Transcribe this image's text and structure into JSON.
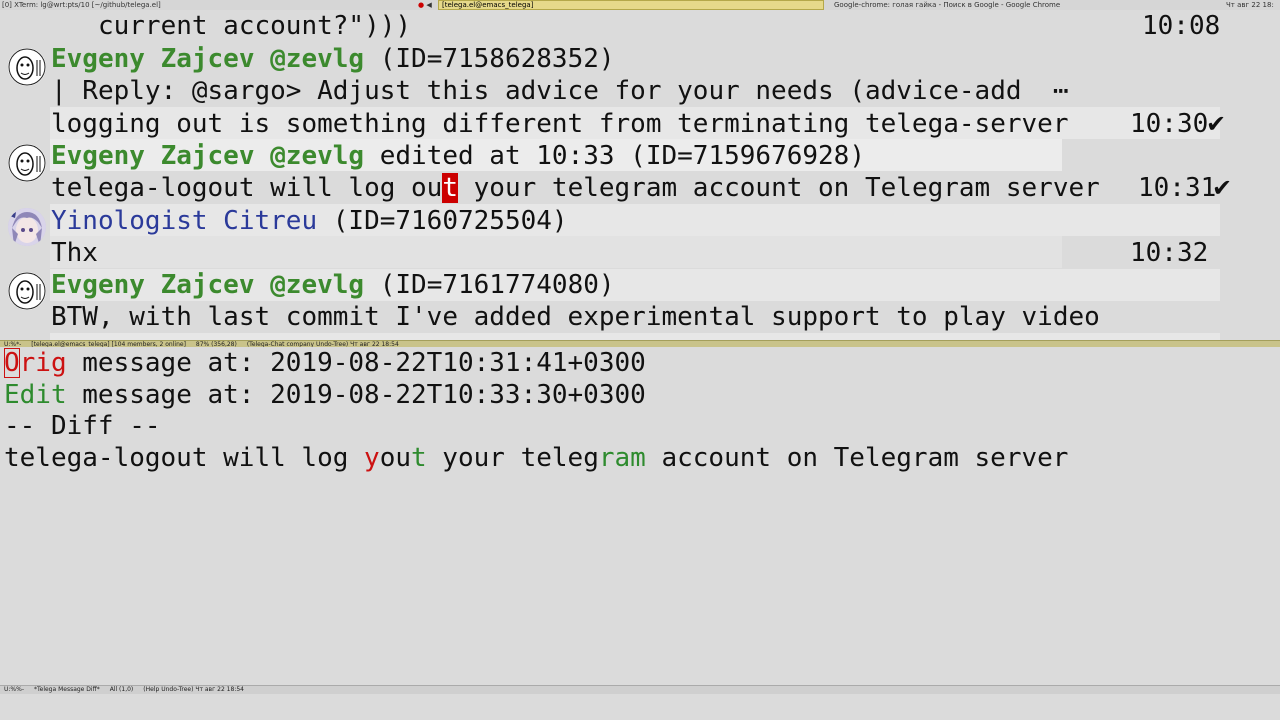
{
  "topbar": {
    "left": "[0]  XTerm: lg@wrt:pts/10 [~/github/telega.el]",
    "active": "[telega.el@emacs_telega]",
    "right": "Google-chrome: голая гайка - Поиск в Google - Google Chrome",
    "clock": "Чт авг 22 18:"
  },
  "chat": {
    "prev_tail": "   current account?\")))",
    "prev_time": "10:08",
    "messages": [
      {
        "sender": "Evgeny Zajcev @zevlg",
        "sender_meta": " (ID=7158628352)",
        "reply": "| Reply: @sargo> Adjust this advice for your needs (advice-add  ⋯",
        "text": "logging out is something different from terminating telega-server",
        "time": "10:30",
        "status": "✔"
      },
      {
        "sender": "Evgeny Zajcev @zevlg",
        "sender_meta": " edited at 10:33 (ID=7159676928)",
        "text_before_cursor": "telega-logout will log ou",
        "cursor_char": "t",
        "text_after_cursor": " your telegram account on Telegram server",
        "time": "10:31",
        "status": "✔"
      },
      {
        "sender": "Yinologist Citreu",
        "sender_meta": " (ID=7160725504)",
        "text": "Thx",
        "time": "10:32"
      },
      {
        "sender": "Evgeny Zajcev @zevlg",
        "sender_meta": " (ID=7161774080)",
        "text": "BTW, with last commit I've added experimental support to play video"
      }
    ]
  },
  "modeline1": {
    "status": "U:%*-",
    "buffer": "[telega.el@emacs_telega] [104 members, 2 online]",
    "position": "87% (356,28)",
    "modes": "(Telega-Chat company Undo-Tree) Чт авг 22 18:54"
  },
  "diff": {
    "orig_label_first": "O",
    "orig_label_rest": "rig",
    "orig_text": " message at: 2019-08-22T10:31:41+0300",
    "edit_label": "Edit",
    "edit_text": " message at: 2019-08-22T10:33:30+0300",
    "diff_header": "-- Diff --",
    "d1": "telega-logout will log ",
    "d2_red": "y",
    "d3": "ou",
    "d4_green": "t",
    "d5": " your teleg",
    "d6_green": "ram",
    "d7": " account on Telegram server"
  },
  "modeline2": {
    "status": "U:%%-",
    "buffer": "*Telega Message Diff*",
    "position": "All (1,0)",
    "modes": "(Help Undo-Tree) Чт авг 22 18:54"
  },
  "colors": {
    "sender_green": "#3c8a2e",
    "sender_blue": "#2b3a9a",
    "cursor_red": "#cc0000",
    "diff_red": "#cc1111",
    "diff_green": "#2e8b2e"
  }
}
